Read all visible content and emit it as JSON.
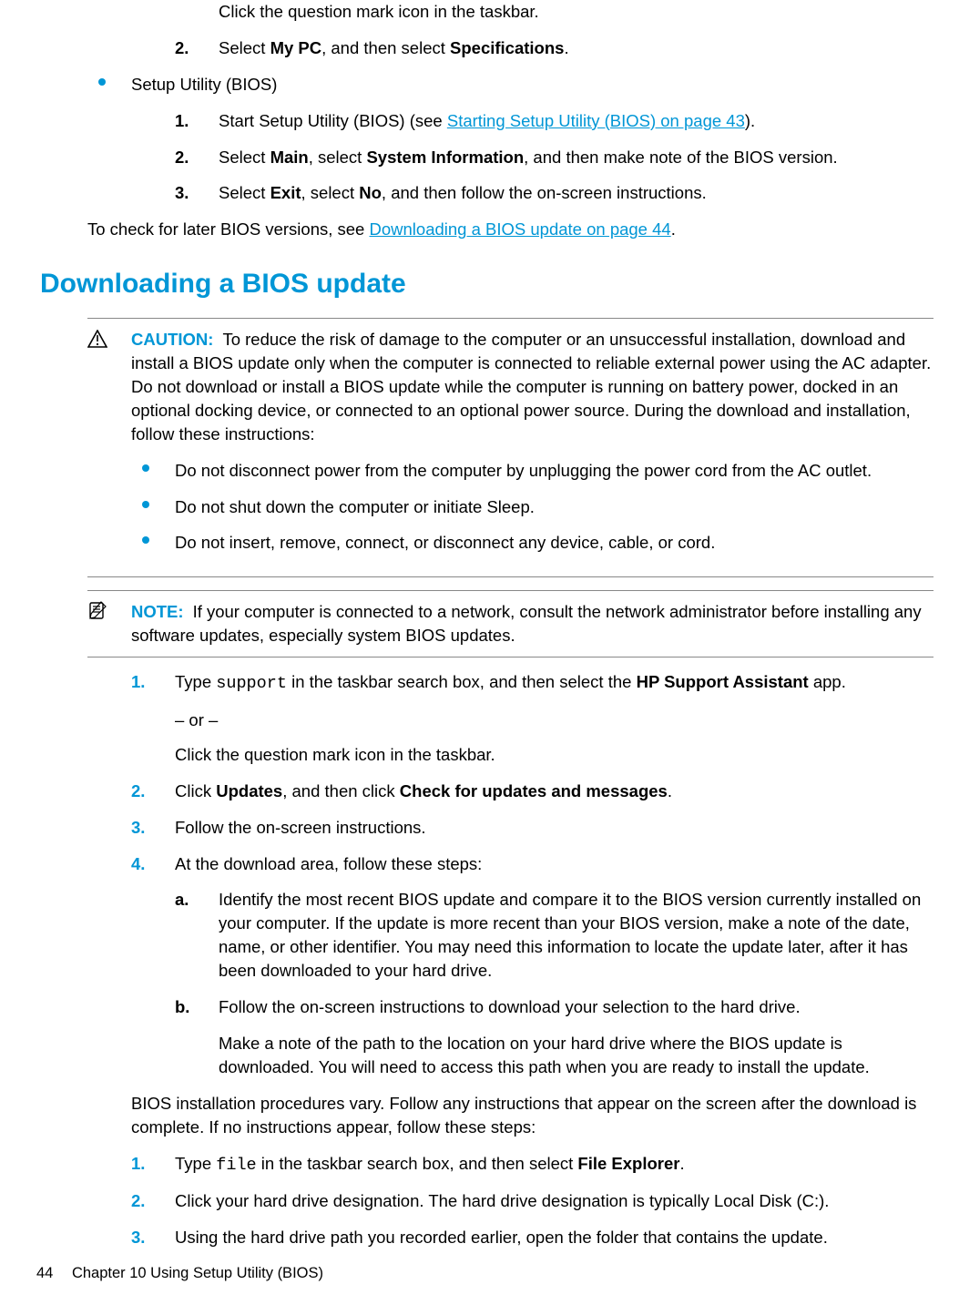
{
  "top_fragment": "Click the question mark icon in the taskbar.",
  "top_step2": {
    "marker": "2.",
    "pre": "Select ",
    "bold1": "My PC",
    "mid": ", and then select ",
    "bold2": "Specifications",
    "post": "."
  },
  "bullet_setup": "Setup Utility (BIOS)",
  "bios_steps": {
    "s1": {
      "marker": "1.",
      "pre": "Start Setup Utility (BIOS) (see ",
      "link": "Starting Setup Utility (BIOS) on page 43",
      "post": ")."
    },
    "s2": {
      "marker": "2.",
      "pre": "Select ",
      "b1": "Main",
      "mid1": ", select ",
      "b2": "System Information",
      "post": ", and then make note of the BIOS version."
    },
    "s3": {
      "marker": "3.",
      "pre": "Select ",
      "b1": "Exit",
      "mid1": ", select ",
      "b2": "No",
      "post": ", and then follow the on-screen instructions."
    }
  },
  "check_later": {
    "pre": "To check for later BIOS versions, see ",
    "link": "Downloading a BIOS update on page 44",
    "post": "."
  },
  "heading": "Downloading a BIOS update",
  "caution": {
    "label": "CAUTION:",
    "text": "To reduce the risk of damage to the computer or an unsuccessful installation, download and install a BIOS update only when the computer is connected to reliable external power using the AC adapter. Do not download or install a BIOS update while the computer is running on battery power, docked in an optional docking device, or connected to an optional power source. During the download and installation, follow these instructions:",
    "b1": "Do not disconnect power from the computer by unplugging the power cord from the AC outlet.",
    "b2": "Do not shut down the computer or initiate Sleep.",
    "b3": "Do not insert, remove, connect, or disconnect any device, cable, or cord."
  },
  "note": {
    "label": "NOTE:",
    "text": "If your computer is connected to a network, consult the network administrator before installing any software updates, especially system BIOS updates."
  },
  "steps_a": {
    "s1": {
      "marker": "1.",
      "pre": "Type ",
      "code": "support",
      "mid": " in the taskbar search box, and then select the ",
      "bold": "HP Support Assistant",
      "post": " app."
    },
    "or": "– or –",
    "s1_alt": "Click the question mark icon in the taskbar.",
    "s2": {
      "marker": "2.",
      "pre": "Click ",
      "b1": "Updates",
      "mid": ", and then click ",
      "b2": "Check for updates and messages",
      "post": "."
    },
    "s3": {
      "marker": "3.",
      "text": "Follow the on-screen instructions."
    },
    "s4": {
      "marker": "4.",
      "text": "At the download area, follow these steps:"
    }
  },
  "sub_steps": {
    "a": {
      "marker": "a.",
      "text": "Identify the most recent BIOS update and compare it to the BIOS version currently installed on your computer. If the update is more recent than your BIOS version, make a note of the date, name, or other identifier. You may need this information to locate the update later, after it has been downloaded to your hard drive."
    },
    "b": {
      "marker": "b.",
      "text": "Follow the on-screen instructions to download your selection to the hard drive.",
      "para": "Make a note of the path to the location on your hard drive where the BIOS update is downloaded. You will need to access this path when you are ready to install the update."
    }
  },
  "bios_vary": "BIOS installation procedures vary. Follow any instructions that appear on the screen after the download is complete. If no instructions appear, follow these steps:",
  "steps_b": {
    "s1": {
      "marker": "1.",
      "pre": "Type ",
      "code": "file",
      "mid": " in the taskbar search box, and then select ",
      "bold": "File Explorer",
      "post": "."
    },
    "s2": {
      "marker": "2.",
      "text": "Click your hard drive designation. The hard drive designation is typically Local Disk (C:)."
    },
    "s3": {
      "marker": "3.",
      "text": "Using the hard drive path you recorded earlier, open the folder that contains the update."
    }
  },
  "footer": {
    "page": "44",
    "chapter": "Chapter 10   Using Setup Utility (BIOS)"
  }
}
